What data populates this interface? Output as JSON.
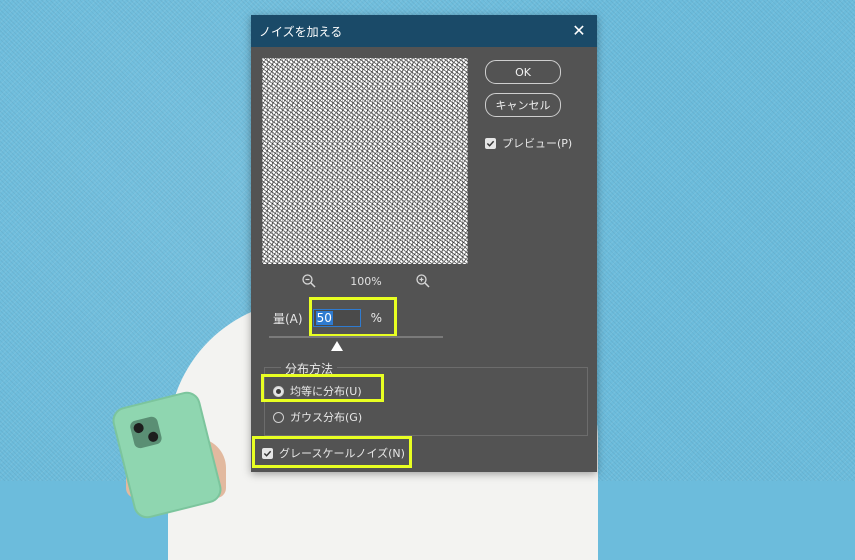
{
  "dialog": {
    "title": "ノイズを加える",
    "close_glyph": "✕",
    "ok_label": "OK",
    "cancel_label": "キャンセル",
    "preview_label": "プレビュー(P)",
    "preview_checked": true,
    "zoom": {
      "zoom_out_icon": "zoom-out-icon",
      "zoom_in_icon": "zoom-in-icon",
      "level": "100%"
    },
    "amount": {
      "label": "量(A)",
      "value": "50",
      "unit": "%"
    },
    "distribution": {
      "title": "分布方法",
      "options": [
        {
          "label": "均等に分布(U)",
          "selected": true
        },
        {
          "label": "ガウス分布(G)",
          "selected": false
        }
      ]
    },
    "monochromatic": {
      "label": "グレースケールノイズ(N)",
      "checked": true
    }
  },
  "colors": {
    "title_bar": "#1a4a68",
    "dialog_bg": "#535353",
    "highlight": "#e8ff22",
    "selection": "#2f7bd0",
    "background": "#6cbcdc"
  }
}
